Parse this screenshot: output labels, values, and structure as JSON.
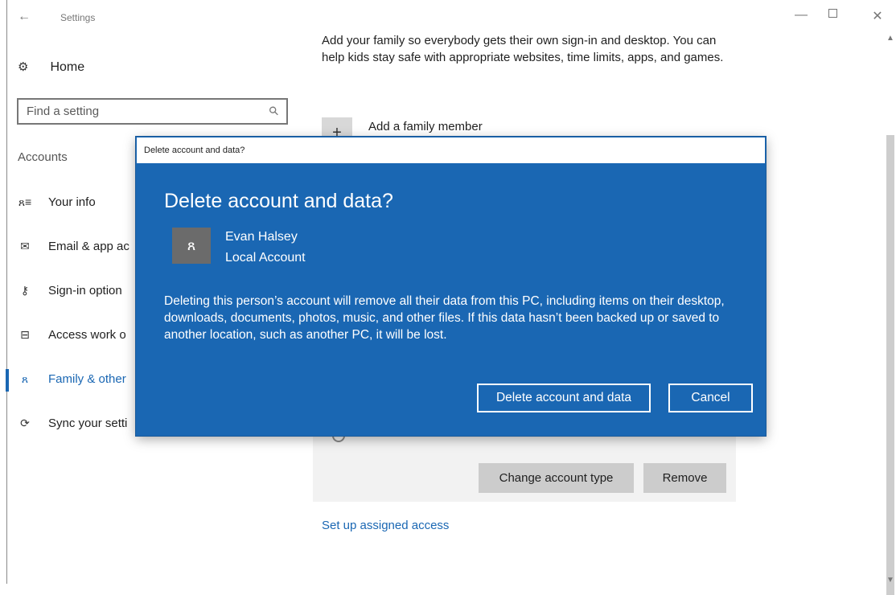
{
  "window": {
    "app_title": "Settings",
    "back_glyph": "←",
    "minimize_glyph": "—",
    "close_glyph": "✕"
  },
  "sidebar": {
    "home_label": "Home",
    "home_icon": "gear-icon",
    "search_placeholder": "Find a setting",
    "section_label": "Accounts",
    "items": [
      {
        "label": "Your info",
        "icon": "person-card-icon",
        "glyph": "ጸ≡",
        "active": false
      },
      {
        "label": "Email & app ac",
        "icon": "mail-icon",
        "glyph": "✉",
        "active": false
      },
      {
        "label": "Sign-in option",
        "icon": "key-icon",
        "glyph": "⚷",
        "active": false
      },
      {
        "label": "Access work o",
        "icon": "briefcase-icon",
        "glyph": "⊟",
        "active": false
      },
      {
        "label": "Family & other",
        "icon": "people-icon",
        "glyph": "ጸ",
        "active": true
      },
      {
        "label": "Sync your setti",
        "icon": "sync-icon",
        "glyph": "⟳",
        "active": false
      }
    ]
  },
  "main": {
    "intro_text": "Add your family so everybody gets their own sign-in and desktop. You can help kids stay safe with appropriate websites, time limits, apps, and games.",
    "add_member_label": "Add a family member",
    "change_account_type_label": "Change account type",
    "remove_label": "Remove",
    "assigned_access_link": "Set up assigned access"
  },
  "dialog": {
    "window_title": "Delete account and data?",
    "heading": "Delete account and data?",
    "user_name": "Evan Halsey",
    "user_type": "Local Account",
    "body": "Deleting this person’s account will remove all their data from this PC, including items on their desktop, downloads, documents, photos, music, and other files. If this data hasn’t been backed up or saved to another location, such as another PC, it will be lost.",
    "delete_button": "Delete account and data",
    "cancel_button": "Cancel"
  },
  "colors": {
    "accent": "#1a67b3",
    "dialog_bg": "#1a67b3",
    "button_grey": "#cccccc",
    "avatar_bg": "#6b6b6b"
  }
}
